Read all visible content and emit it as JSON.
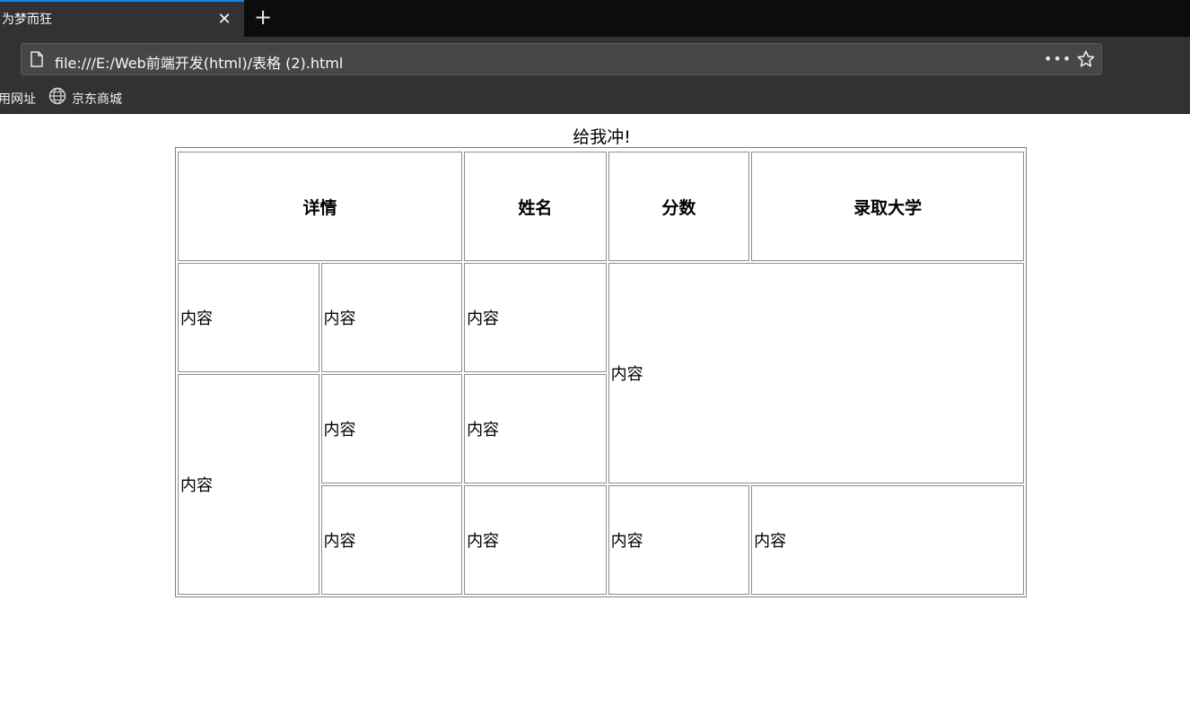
{
  "browser": {
    "tab_title": "为梦而狂",
    "close_label": "✕",
    "new_tab_label": "+",
    "url": "file:///E:/Web前端开发(html)/表格 (2).html",
    "more_label": "•••",
    "bookmarks": [
      {
        "label": "用网址"
      },
      {
        "label": "京东商城",
        "icon": "globe-icon"
      }
    ]
  },
  "table": {
    "caption": "给我冲!",
    "headers": [
      "详情",
      "姓名",
      "分数",
      "录取大学"
    ],
    "cell": "内容"
  }
}
